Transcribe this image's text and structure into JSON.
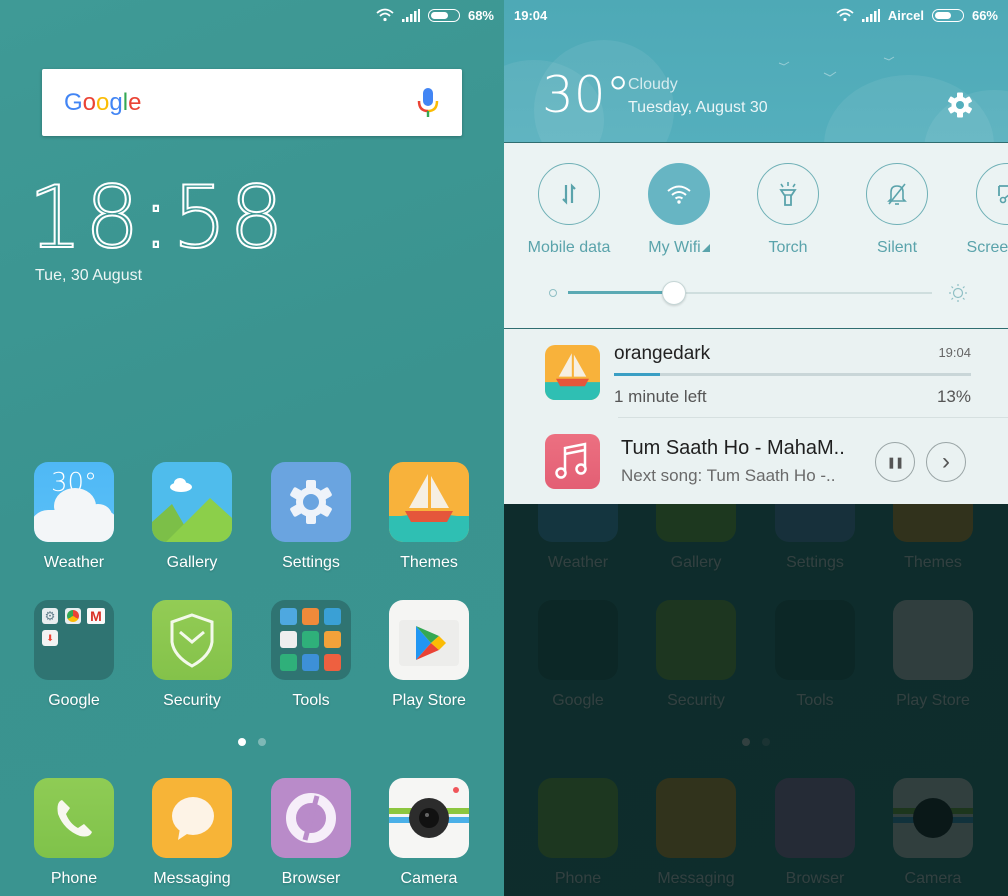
{
  "left": {
    "status": {
      "battery_pct_label": "68%",
      "battery_level": 0.68,
      "icons": [
        "wifi-icon",
        "signal-icon",
        "battery-icon"
      ]
    },
    "search": {
      "logo": "Google",
      "logo_letters": [
        "G",
        "o",
        "o",
        "g",
        "l",
        "e"
      ],
      "mic_icon": "mic-icon"
    },
    "clock": {
      "time": "18:58",
      "date": "Tue, 30 August"
    },
    "apps": [
      {
        "label": "Weather",
        "icon": "weather-icon",
        "temp": "30°"
      },
      {
        "label": "Gallery",
        "icon": "gallery-icon"
      },
      {
        "label": "Settings",
        "icon": "settings-icon"
      },
      {
        "label": "Themes",
        "icon": "themes-icon"
      },
      {
        "label": "Google",
        "icon": "google-folder-icon"
      },
      {
        "label": "Security",
        "icon": "security-icon"
      },
      {
        "label": "Tools",
        "icon": "tools-folder-icon"
      },
      {
        "label": "Play Store",
        "icon": "play-store-icon"
      }
    ],
    "page_indicator": {
      "pages": 2,
      "active": 1
    },
    "dock": [
      {
        "label": "Phone",
        "icon": "phone-icon"
      },
      {
        "label": "Messaging",
        "icon": "messaging-icon"
      },
      {
        "label": "Browser",
        "icon": "browser-icon"
      },
      {
        "label": "Camera",
        "icon": "camera-icon"
      }
    ]
  },
  "right": {
    "status": {
      "time": "19:04",
      "carrier": "Aircel",
      "battery_pct_label": "66%",
      "battery_level": 0.66
    },
    "weather": {
      "temp": "30°",
      "condition": "Cloudy",
      "date": "Tuesday, August 30",
      "settings_icon": "gear-icon"
    },
    "quick_settings": [
      {
        "label": "Mobile data",
        "icon": "mobile-data-icon",
        "active": false
      },
      {
        "label": "My Wifi",
        "icon": "wifi-icon",
        "active": true
      },
      {
        "label": "Torch",
        "icon": "torch-icon",
        "active": false
      },
      {
        "label": "Silent",
        "icon": "silent-icon",
        "active": false
      },
      {
        "label": "Screenshot",
        "icon": "screenshot-icon",
        "active": false
      }
    ],
    "brightness": {
      "level": 0.29
    },
    "notifications": {
      "download": {
        "title": "orangedark",
        "time": "19:04",
        "subtitle": "1 minute left",
        "percent_label": "13%",
        "progress": 0.13
      },
      "music": {
        "title": "Tum Saath Ho - MahaM..",
        "subtitle": "Next song: Tum Saath Ho -..",
        "pause_label": "❚❚",
        "next_label": "›"
      }
    },
    "background_apps": [
      "Weather",
      "Gallery",
      "Settings",
      "Themes",
      "Google",
      "Security",
      "Tools",
      "Play Store",
      "Phone",
      "Messaging",
      "Browser",
      "Camera"
    ]
  },
  "colors": {
    "wallpaper": "#3c9692",
    "accent": "#67b5c3",
    "qs_label": "#5aa3ab",
    "progress": "#3a9fc4"
  }
}
